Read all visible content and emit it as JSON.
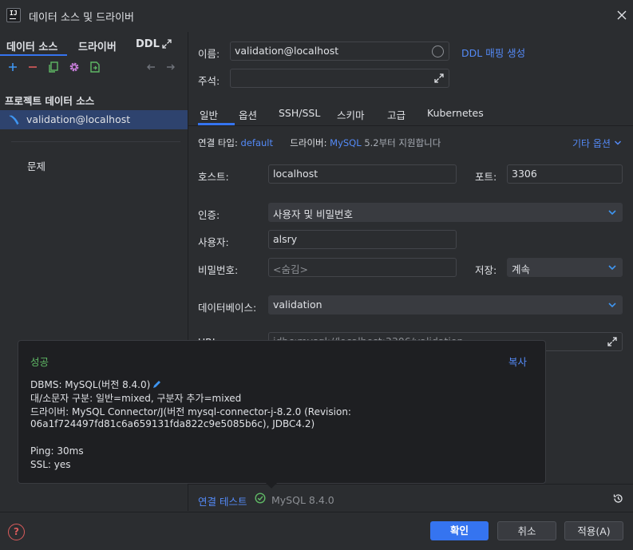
{
  "window": {
    "title": "데이터 소스 및 드라이버"
  },
  "left": {
    "tabs": [
      "데이터 소스",
      "드라이버",
      "DDL"
    ],
    "section_title": "프로젝트 데이터 소스",
    "datasource": "validation@localhost",
    "problems": "문제"
  },
  "form": {
    "name_label": "이름:",
    "name_value": "validation@localhost",
    "ddl_link": "DDL 매핑 생성",
    "comment_label": "주석:",
    "comment_value": "",
    "tabs": [
      "일반",
      "옵션",
      "SSH/SSL",
      "스키마",
      "고급",
      "Kubernetes"
    ],
    "conn_type_label": "연결 타입:",
    "conn_type_value": "default",
    "driver_label": "드라이버:",
    "driver_value": "MySQL",
    "driver_note": "5.2부터 지원합니다",
    "more_options": "기타 옵션",
    "host_label": "호스트:",
    "host_value": "localhost",
    "port_label": "포트:",
    "port_value": "3306",
    "auth_label": "인증:",
    "auth_value": "사용자 및 비밀번호",
    "user_label": "사용자:",
    "user_value": "alsry",
    "password_label": "비밀번호:",
    "password_value": "<숨김>",
    "save_label": "저장:",
    "save_value": "계속",
    "database_label": "데이터베이스:",
    "database_value": "validation",
    "url_label": "URL:",
    "url_value": "jdbc:mysql://localhost:3306/validation"
  },
  "popup": {
    "title": "성공",
    "copy": "복사",
    "lines": [
      "DBMS: MySQL(버전 8.4.0)",
      "대/소문자 구분: 일반=mixed, 구분자 추가=mixed",
      "드라이버: MySQL Connector/J(버전 mysql-connector-j-8.2.0 (Revision:",
      "06a1f724497fd81c6a659131fda822c9e5085b6c), JDBC4.2)",
      "Ping: 30ms",
      "SSL: yes"
    ]
  },
  "bottom": {
    "test_link": "연결 테스트",
    "test_result": "MySQL 8.4.0"
  },
  "footer": {
    "help": "?",
    "ok": "확인",
    "cancel": "취소",
    "apply": "적용(A)"
  }
}
